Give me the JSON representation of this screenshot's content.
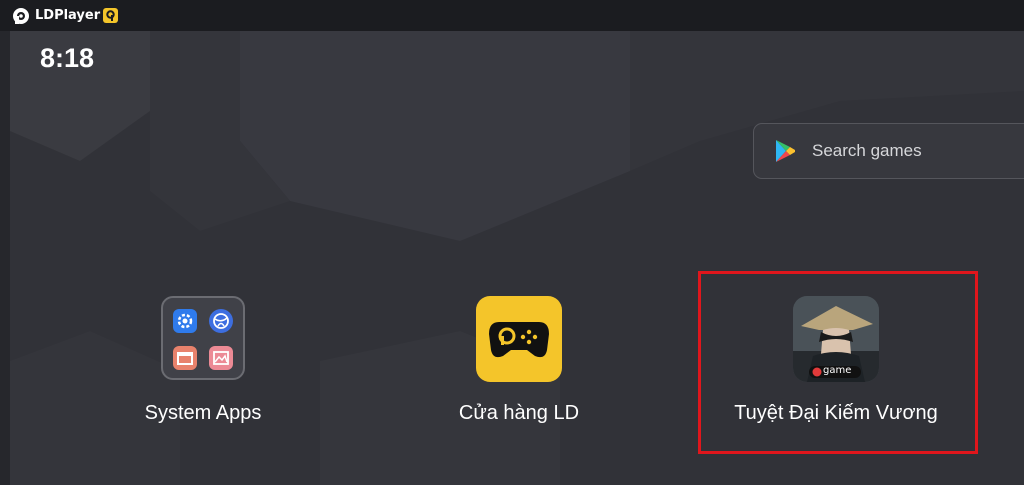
{
  "titlebar": {
    "app_name": "LDPlayer",
    "vip_badge": "9"
  },
  "status": {
    "time": "8:18"
  },
  "search": {
    "placeholder": "Search games",
    "icon": "play-store-icon"
  },
  "apps": [
    {
      "label": "System Apps",
      "icon": "folder-icon"
    },
    {
      "label": "Cửa hàng LD",
      "icon": "ld-store-icon"
    },
    {
      "label": "Tuyệt Đại Kiếm Vương",
      "icon": "game-icon",
      "badge_text": "game"
    }
  ],
  "colors": {
    "accent_yellow": "#f4c52a",
    "highlight_red": "#e0161c",
    "background": "#313238"
  }
}
